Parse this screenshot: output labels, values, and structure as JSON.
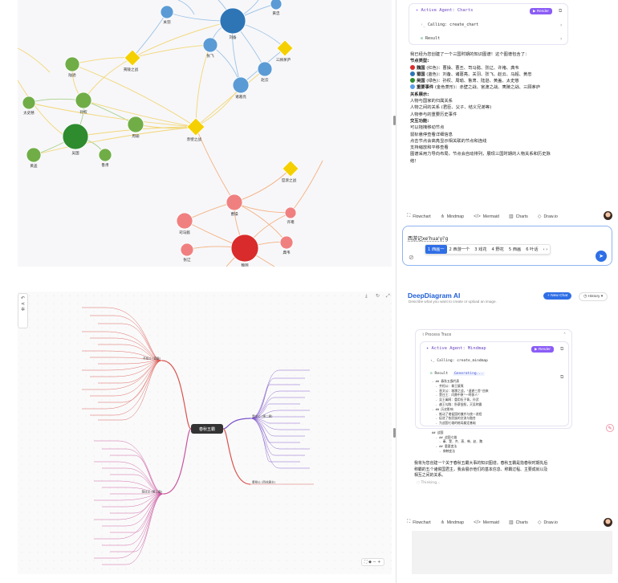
{
  "top": {
    "graph_nodes": [
      {
        "id": "guanyu",
        "label": "关羽",
        "color": "#5b9bd5",
        "group": "shu"
      },
      {
        "id": "liubei",
        "label": "刘备",
        "color": "#2e75b6",
        "group": "shu"
      },
      {
        "id": "huangzhong",
        "label": "黄忠",
        "color": "#5b9bd5",
        "group": "shu"
      },
      {
        "id": "zhangfei",
        "label": "张飞",
        "color": "#5b9bd5",
        "group": "shu"
      },
      {
        "id": "zhaoyun",
        "label": "赵云",
        "color": "#5b9bd5",
        "group": "shu"
      },
      {
        "id": "zhugeliang",
        "label": "诸葛亮",
        "color": "#5b9bd5",
        "group": "shu"
      },
      {
        "id": "sanguyaolu",
        "label": "三顾茅庐",
        "color": "#f5d000",
        "group": "event"
      },
      {
        "id": "yiling",
        "label": "夷陵之战",
        "color": "#f5d000",
        "group": "event"
      },
      {
        "id": "chibi",
        "label": "赤壁之战",
        "color": "#f5d000",
        "group": "event"
      },
      {
        "id": "guandu",
        "label": "官渡之战",
        "color": "#f5d000",
        "group": "event"
      },
      {
        "id": "lusu",
        "label": "陆逊",
        "color": "#70ad47",
        "group": "wu"
      },
      {
        "id": "sunquan",
        "label": "孙权",
        "color": "#70ad47",
        "group": "wu"
      },
      {
        "id": "taishici",
        "label": "太史慈",
        "color": "#70ad47",
        "group": "wu"
      },
      {
        "id": "wuguo",
        "label": "吴国",
        "color": "#2e8b2e",
        "group": "wu"
      },
      {
        "id": "zhouyu",
        "label": "周瑜",
        "color": "#70ad47",
        "group": "wu"
      },
      {
        "id": "lumeng",
        "label": "鲁肃",
        "color": "#70ad47",
        "group": "wu"
      },
      {
        "id": "huanggai",
        "label": "黄盖",
        "color": "#70ad47",
        "group": "wu"
      },
      {
        "id": "caocao",
        "label": "曹操",
        "color": "#f08080",
        "group": "wei"
      },
      {
        "id": "simayi",
        "label": "司马懿",
        "color": "#f08080",
        "group": "wei"
      },
      {
        "id": "xuchu",
        "label": "许褚",
        "color": "#f08080",
        "group": "wei"
      },
      {
        "id": "weiguo",
        "label": "魏国",
        "color": "#d92b2b",
        "group": "wei"
      },
      {
        "id": "dianwei",
        "label": "典韦",
        "color": "#f08080",
        "group": "wei"
      },
      {
        "id": "zhangliao",
        "label": "张辽",
        "color": "#f08080",
        "group": "wei"
      }
    ],
    "agent": {
      "title": "Active Agent: Charts",
      "badge": "Render",
      "calling": "Calling: create_chart",
      "result": "Result"
    },
    "message_lines": [
      {
        "text": "我已经为您创建了一个三国时期的知识图谱！这个图谱包含了：",
        "bold": false
      },
      {
        "text": "节点类型:",
        "bold": true
      },
      {
        "text": "魏国 (红色)：曹操、曹丕、司马懿、张辽、许褚、典韦",
        "bold": false,
        "dot": "#d92b2b",
        "boldPrefix": "魏国"
      },
      {
        "text": "蜀国 (蓝色)：刘备、诸葛亮、关羽、张飞、赵云、马超、黄忠",
        "bold": false,
        "dot": "#2e75b6",
        "boldPrefix": "蜀国"
      },
      {
        "text": "吴国 (绿色)：孙权、周瑜、鲁肃、陆逊、黄盖、太史慈",
        "bold": false,
        "dot": "#2e8b2e",
        "boldPrefix": "吴国"
      },
      {
        "text": "重要事件 (金色菱形)：赤壁之战、官渡之战、夷陵之战、三顾茅庐",
        "bold": false,
        "dot": "#5aa0e6",
        "boldPrefix": "重要事件"
      },
      {
        "text": "关系展示:",
        "bold": true
      },
      {
        "text": "人物与国家的归属关系",
        "bold": false
      },
      {
        "text": "人物之间的关系 (君臣、父子、结义兄弟等)",
        "bold": false
      },
      {
        "text": "人物参与的重要历史事件",
        "bold": false
      },
      {
        "text": "交互功能:",
        "bold": true
      },
      {
        "text": "可以拖拽移动节点",
        "bold": false
      },
      {
        "text": "鼠标悬停查看详细信息",
        "bold": false
      },
      {
        "text": "点击节点会高亮显示相关联的节点和连线",
        "bold": false
      },
      {
        "text": "支持缩放和平移查看",
        "bold": false
      },
      {
        "text": "图谱采用力导向布局，节点会自动排列，展现三国时期的人物关系和历史脉",
        "bold": false
      },
      {
        "text": "络！",
        "bold": false
      }
    ],
    "tabs": [
      {
        "icon": "⛶",
        "label": "Flowchart"
      },
      {
        "icon": "⋔",
        "label": "Mindmap"
      },
      {
        "icon": "</>",
        "label": "Mermaid"
      },
      {
        "icon": "▥",
        "label": "Charts"
      },
      {
        "icon": "◇",
        "label": "Draw.io"
      }
    ],
    "input_value": "西游记xe'hua'yi'g",
    "ime_candidates": [
      "1 西画一",
      "2 西游一个",
      "3 戏花",
      "4 野花",
      "5 西画",
      "6 叶话"
    ]
  },
  "bottom": {
    "brand": "DeepDiagram AI",
    "subtitle": "Describe what you want to create or upload an image.",
    "new_chat": "+ New Chat",
    "history": "History",
    "process_trace": "Process Trace",
    "agent": {
      "title": "Active Agent: Mindmap",
      "badge": "Render",
      "calling": "Calling: create_mindmap",
      "result": "Result",
      "status": "Generating..."
    },
    "code_lines": [
      "- ## 春秋五霸代表",
      "  - 齐桓公：尊王攘夷",
      "  - 晋文公：城濮之战，\"退避三舍\"由来",
      "  - 楚庄王：问鼎中原\"一鸣惊人\"",
      "  - 吴王阖闾：重用伍子胥，孙武",
      "  - 越王勾践：卧薪尝胆，灭吴称霸",
      "- ## 历史影响",
      "  - 推动了诸侯国的兼并与统一进程",
      "  - 促进了各民族的交流与融合",
      "  - 为战国七雄的格局奠定基础",
      "",
      "## 战国",
      "  - ## 战国七雄",
      "    - 秦、楚、齐、燕、韩、赵、魏",
      "  - ## 重要变法",
      "    - 商鞅变法"
    ],
    "reply_lines": [
      "我将为您创建一个关于春秋五霸大事的知识图谱。春秋五霸是指春秋时期先后",
      "称霸的五个诸侯国君主，我会展示他们的基本信息、称霸过程、主要成就以及",
      "相互之间的关系。"
    ],
    "typing": "Thinking...",
    "tabs": [
      {
        "icon": "⛶",
        "label": "Flowchart"
      },
      {
        "icon": "⋔",
        "label": "Mindmap"
      },
      {
        "icon": "</>",
        "label": "Mermaid"
      },
      {
        "icon": "▥",
        "label": "Charts"
      },
      {
        "icon": "◇",
        "label": "Draw.io"
      }
    ],
    "mindmap": {
      "center": "春秋五霸",
      "branches": [
        {
          "label": "齐桓公 (首霸)",
          "color": "#d9534f",
          "side": "left"
        },
        {
          "label": "晋文公 (第二霸)",
          "color": "#7b52c9",
          "side": "right"
        },
        {
          "label": "楚庄王 (第三霸)",
          "color": "#c9529c",
          "side": "left"
        },
        {
          "label": "秦穆公 (西戎霸主)",
          "color": "#d9534f",
          "side": "right"
        }
      ]
    }
  }
}
